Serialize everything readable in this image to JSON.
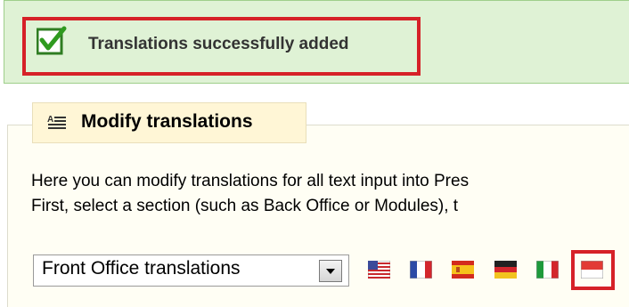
{
  "success": {
    "message": "Translations successfully added",
    "icon": "checkbox-check-icon",
    "highlight_color": "#d62128"
  },
  "panel": {
    "title": "Modify translations",
    "title_icon": "text-lines-icon",
    "description_line1": "Here you can modify translations for all text input into Pres",
    "description_line2": "First, select a section (such as Back Office or Modules), t"
  },
  "section_select": {
    "selected": "Front Office translations"
  },
  "flags": [
    {
      "name": "us-flag-icon"
    },
    {
      "name": "france-flag-icon"
    },
    {
      "name": "spain-flag-icon"
    },
    {
      "name": "germany-flag-icon"
    },
    {
      "name": "italy-flag-icon"
    },
    {
      "name": "indonesia-flag-icon"
    }
  ],
  "colors": {
    "success_bg": "#dff2d5",
    "panel_bg": "#fffef4",
    "legend_bg": "#fff6d6",
    "highlight": "#d62128"
  }
}
